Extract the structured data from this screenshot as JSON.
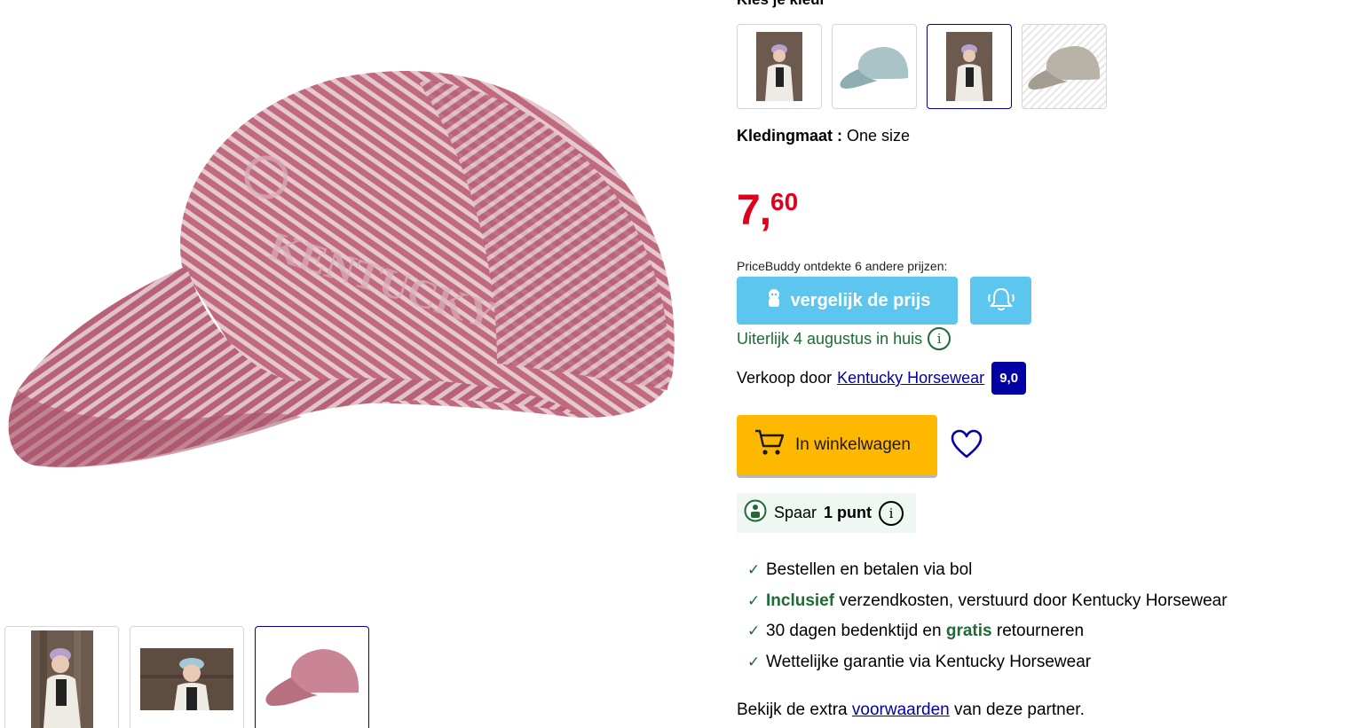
{
  "variants": {
    "heading": "Kies je kleur",
    "options": [
      {
        "name": "woman-with-purple-cap",
        "selected": false
      },
      {
        "name": "light-blue-cap",
        "selected": false
      },
      {
        "name": "woman-with-purple-cap",
        "selected": true
      },
      {
        "name": "beige-cap",
        "selected": false,
        "unavailable": true
      }
    ]
  },
  "size": {
    "label": "Kledingmaat :",
    "value": "One size"
  },
  "price": {
    "whole": "7",
    "separator": ",",
    "cents": "60",
    "color": "#e0001b"
  },
  "pricebuddy": {
    "text": "PriceBuddy ontdekte 6 andere prijzen:",
    "compare_label": "vergelijk de prijs",
    "color": "#5cc6ef"
  },
  "delivery": {
    "text": "Uiterlijk 4 augustus in huis",
    "info": "i"
  },
  "seller": {
    "prefix": "Verkoop door",
    "name": "Kentucky Horsewear",
    "rating": "9,0"
  },
  "cart": {
    "label": "In winkelwagen",
    "color": "#ffb800"
  },
  "points": {
    "prefix": "Spaar",
    "amount": "1 punt",
    "info": "i"
  },
  "usps": [
    {
      "before": "Bestellen en betalen via bol",
      "highlight": "",
      "after": ""
    },
    {
      "before": "",
      "highlight": "Inclusief",
      "after": " verzendkosten, verstuurd door Kentucky Horsewear"
    },
    {
      "before": "30 dagen bedenktijd en ",
      "highlight": "gratis",
      "after": " retourneren"
    },
    {
      "before": "Wettelijke garantie via Kentucky Horsewear",
      "highlight": "",
      "after": ""
    }
  ],
  "terms": {
    "before": "Bekijk de extra",
    "link": "voorwaarden",
    "after": "van deze partner."
  },
  "gallery": {
    "main_image": "pink-herringbone-cap",
    "thumbnails": [
      {
        "name": "woman-with-purple-cap",
        "selected": false
      },
      {
        "name": "woman-with-light-blue-cap",
        "selected": false
      },
      {
        "name": "pink-herringbone-cap",
        "selected": true
      }
    ]
  }
}
